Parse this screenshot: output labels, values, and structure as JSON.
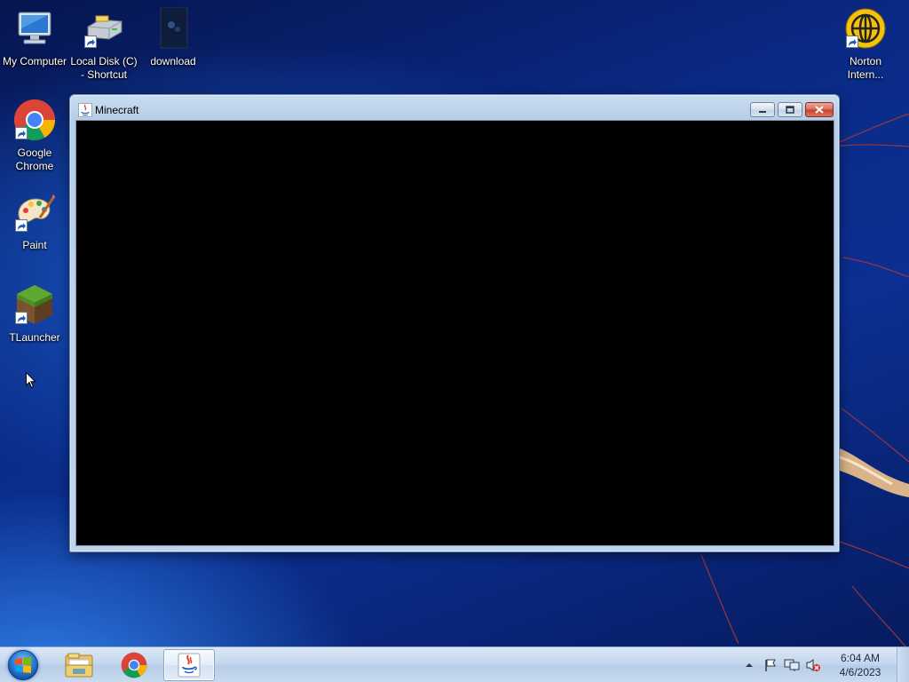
{
  "desktop": {
    "icons": [
      {
        "label": "My Computer",
        "icon": "computer-icon"
      },
      {
        "label": "Local Disk (C)\n- Shortcut",
        "icon": "drive-icon"
      },
      {
        "label": "download",
        "icon": "image-file-icon"
      },
      {
        "label": "Norton\nIntern...",
        "icon": "globe-icon"
      },
      {
        "label": "Google\nChrome",
        "icon": "chrome-icon"
      },
      {
        "label": "Paint",
        "icon": "paint-palette-icon"
      },
      {
        "label": "TLauncher",
        "icon": "grass-block-icon"
      }
    ]
  },
  "window": {
    "title": "Minecraft",
    "icon": "java-icon",
    "client_color": "#000000",
    "buttons": [
      "minimize-icon",
      "maximize-icon",
      "close-icon"
    ]
  },
  "taskbar": {
    "items": [
      {
        "name": "windows-explorer",
        "icon": "folder-icon",
        "active": false
      },
      {
        "name": "google-chrome",
        "icon": "chrome-icon",
        "active": false
      },
      {
        "name": "java-minecraft",
        "icon": "java-icon",
        "active": true
      }
    ],
    "tray_icons": [
      "show-hidden-icons-icon",
      "action-center-flag-icon",
      "network-icon",
      "volume-muted-icon"
    ],
    "clock": {
      "time": "6:04 AM",
      "date": "4/6/2023"
    }
  },
  "colors": {
    "wallpaper_blue": "#0b2f92",
    "window_frame": "#bfd3ea",
    "close_red": "#c7402b"
  }
}
